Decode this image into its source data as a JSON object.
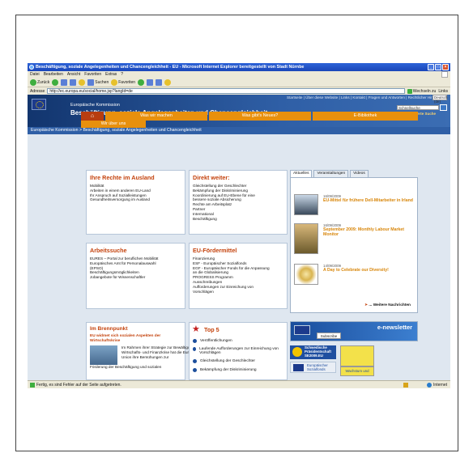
{
  "window": {
    "title": "Beschäftigung, soziale Angelegenheiten und Chancengleichheit - EU - Microsoft Internet Explorer bereitgestellt von Stadt Nürnbe",
    "controls": [
      "_",
      "□",
      "×"
    ]
  },
  "menu": [
    "Datei",
    "Bearbeiten",
    "Ansicht",
    "Favoriten",
    "Extras",
    "?"
  ],
  "toolbar": {
    "back": "Zurück",
    "search": "Suchen",
    "favorites": "Favoriten"
  },
  "address": {
    "label": "Adresse",
    "url": "http://ec.europa.eu/social/home.jsp?langId=de",
    "go": "Wechseln zu",
    "links": "Links"
  },
  "site": {
    "toplinks": "Startseite | Über diese Website | Links | Kontakt | Fragen und Antworten | Rechtlicher Hinweis",
    "language": "Deutsch (de)",
    "commission": "Europäische Kommission",
    "heading": "Beschäftigung, soziale Angelegenheiten und Chancengleichheit",
    "search_placeholder": "Schnellsuche",
    "advanced_search": "Erweiterte Suche",
    "breadcrumb": "Europäische Kommission > Beschäftigung, soziale Angelegenheiten und Chancengleichheit"
  },
  "nav": {
    "home": "⌂",
    "tabs": [
      "Was wir machen",
      "Was gibt's Neues?",
      "E-Bibliothek"
    ],
    "sub": "Wir über uns"
  },
  "panels": {
    "rechte": {
      "title": "Ihre Rechte im Ausland",
      "lines": [
        "Mobilität",
        "Arbeiten in einem anderen EU-Land",
        "Ihr Anspruch auf Sozialleistungen",
        "Gesundheitsversorgung im Ausland"
      ]
    },
    "direkt": {
      "title": "Direkt weiter:",
      "lines": [
        "Gleichstellung der Geschlechter",
        "Bekämpfung der Diskriminierung",
        "Koordinierung auf EU-Ebene für eine",
        "bessere soziale Absicherung",
        "Rechte am Arbeitsplatz",
        "Partner",
        "International",
        "Beschäftigung"
      ]
    },
    "arbeit": {
      "title": "Arbeitssuche",
      "lines": [
        "EURES – Portal zur beruflichen Mobilität",
        "Europäisches Amt für Personalauswahl",
        "(EPSO)",
        "Beschäftigungsmöglichkeiten",
        "Jobangebote für Wissenschaftler"
      ]
    },
    "foerder": {
      "title": "EU-Fördermittel",
      "lines": [
        "Finanzierung",
        "ESF - Europäischer Sozialfonds",
        "EGF - Europäischer Fonds für die Anpassung",
        "an die Globalisierung",
        "PROGRESS Programm",
        "Ausschreibungen",
        "Aufforderungen zur Einreichung von",
        "Vorschlägen"
      ]
    }
  },
  "news": {
    "tabs": [
      "Aktuelles",
      "Veranstaltungen",
      "Videos"
    ],
    "items": [
      {
        "date": "16/09/2009",
        "headline": "EU-Mittel für frühere Dell-Mitarbeiter in Irland"
      },
      {
        "date": "16/09/2009",
        "headline": "September 2009: Monthly Labour Market Monitor"
      },
      {
        "date": "14/09/2009",
        "headline": "A Day to Celebrate our Diversity!"
      }
    ],
    "more": "... Weitere Nachrichten"
  },
  "brennpunkt": {
    "title": "Im Brennpunkt",
    "subtitle": "EU widmet sich sozialen Aspekten der Wirtschaftskrise",
    "text": "Im Rahmen ihrer Strategie zur Bewältigung der Wirtschafts- und Finanzkrise hat die Europäische Union ihre Bemühungen zur",
    "text2": "Förderung der Beschäftigung und sozialen"
  },
  "top5": {
    "title": "Top 5",
    "items": [
      "Veröffentlichungen",
      "Laufende Aufforderungen zur Einreichung von Vorschlägen",
      "Gleichstellung der Geschlechter",
      "Bekämpfung der Diskriminierung"
    ]
  },
  "banners": {
    "enews": "e-newsletter",
    "subscribe": "Subscribe",
    "swedish": "Schwedische Präsidentschaft SE2009.EU",
    "esf": "Europäischer Sozialfonds",
    "growth": "Wachstum und"
  },
  "status": {
    "text": "Fertig, es sind Fehler auf der Seite aufgetreten.",
    "zone": "Internet"
  }
}
